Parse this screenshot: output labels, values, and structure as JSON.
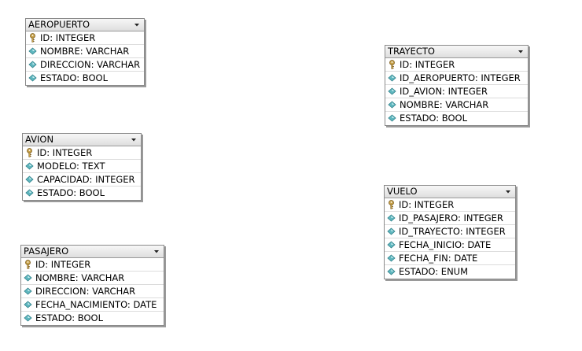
{
  "entities": [
    {
      "name": "AEROPUERTO",
      "fields": [
        {
          "label": "ID: INTEGER",
          "icon": "key-icon"
        },
        {
          "label": "NOMBRE: VARCHAR",
          "icon": "diamond-icon"
        },
        {
          "label": "DIRECCION: VARCHAR",
          "icon": "diamond-icon"
        },
        {
          "label": "ESTADO: BOOL",
          "icon": "diamond-icon"
        }
      ]
    },
    {
      "name": "AVION",
      "fields": [
        {
          "label": "ID: INTEGER",
          "icon": "key-icon"
        },
        {
          "label": "MODELO: TEXT",
          "icon": "diamond-icon"
        },
        {
          "label": "CAPACIDAD: INTEGER",
          "icon": "diamond-icon"
        },
        {
          "label": "ESTADO: BOOL",
          "icon": "diamond-icon"
        }
      ]
    },
    {
      "name": "PASAJERO",
      "fields": [
        {
          "label": "ID: INTEGER",
          "icon": "key-icon"
        },
        {
          "label": "NOMBRE: VARCHAR",
          "icon": "diamond-icon"
        },
        {
          "label": "DIRECCION: VARCHAR",
          "icon": "diamond-icon"
        },
        {
          "label": "FECHA_NACIMIENTO: DATE",
          "icon": "diamond-icon"
        },
        {
          "label": "ESTADO: BOOL",
          "icon": "diamond-icon"
        }
      ]
    },
    {
      "name": "TRAYECTO",
      "fields": [
        {
          "label": "ID: INTEGER",
          "icon": "key-icon"
        },
        {
          "label": "ID_AEROPUERTO: INTEGER",
          "icon": "diamond-icon"
        },
        {
          "label": "ID_AVION: INTEGER",
          "icon": "diamond-icon"
        },
        {
          "label": "NOMBRE: VARCHAR",
          "icon": "diamond-icon"
        },
        {
          "label": "ESTADO: BOOL",
          "icon": "diamond-icon"
        }
      ]
    },
    {
      "name": "VUELO",
      "fields": [
        {
          "label": "ID: INTEGER",
          "icon": "key-icon"
        },
        {
          "label": "ID_PASAJERO: INTEGER",
          "icon": "diamond-icon"
        },
        {
          "label": "ID_TRAYECTO: INTEGER",
          "icon": "diamond-icon"
        },
        {
          "label": "FECHA_INICIO: DATE",
          "icon": "diamond-icon"
        },
        {
          "label": "FECHA_FIN: DATE",
          "icon": "diamond-icon"
        },
        {
          "label": "ESTADO: ENUM",
          "icon": "diamond-icon"
        }
      ]
    }
  ],
  "colors": {
    "header_gradient_top": "#f7f7f7",
    "header_gradient_bottom": "#dedede",
    "border": "#8a8a8a",
    "diamond_fill": "#5fb7bf",
    "key_fill": "#c8a24a"
  }
}
